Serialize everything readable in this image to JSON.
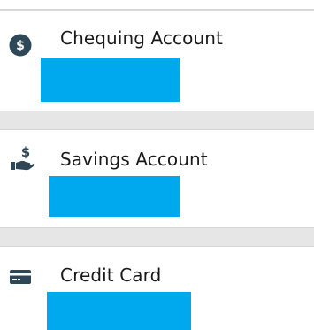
{
  "colors": {
    "accent": "#00a9ee",
    "icon": "#2f4858",
    "divider": "#e6e6e6"
  },
  "accounts": [
    {
      "label": "Chequing Account",
      "icon": "dollar-coin-icon"
    },
    {
      "label": "Savings Account",
      "icon": "hand-dollar-icon"
    },
    {
      "label": "Credit Card",
      "icon": "credit-card-icon"
    }
  ]
}
